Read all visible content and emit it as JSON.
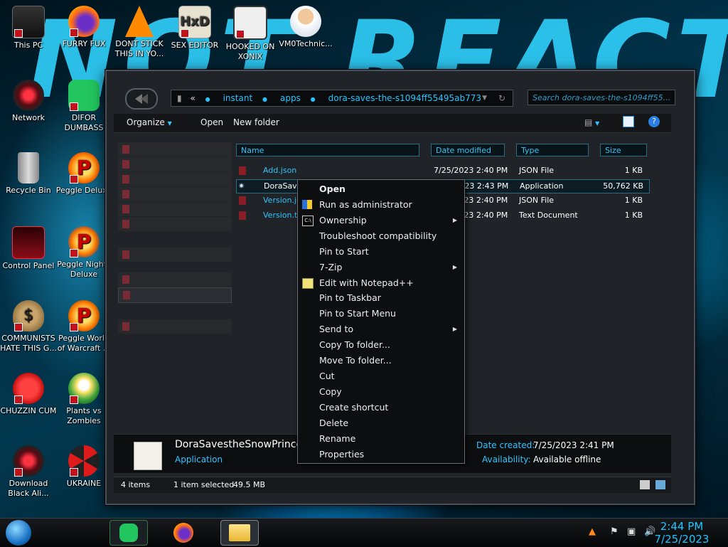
{
  "desktop": {
    "icons": [
      {
        "label": "This PC"
      },
      {
        "label": "FURRY FUX"
      },
      {
        "label": "DONT STICK THIS IN YO..."
      },
      {
        "label": "SEX EDITOR"
      },
      {
        "label": "HOOKED ON XONIX"
      },
      {
        "label": "VM0Technic..."
      },
      {
        "label": "Network"
      },
      {
        "label": "DIFOR DUMBASS"
      },
      {
        "label": "Recycle Bin"
      },
      {
        "label": "Peggle Deluxe"
      },
      {
        "label": "Control Panel"
      },
      {
        "label": "Peggle Nights Deluxe"
      },
      {
        "label": "COMMUNISTS HATE THIS G..."
      },
      {
        "label": "Peggle World of Warcraft ..."
      },
      {
        "label": "CHUZZIN CUM"
      },
      {
        "label": "Plants vs Zombies"
      },
      {
        "label": "Download Black Ali..."
      },
      {
        "label": "UKRAINE"
      }
    ]
  },
  "explorer": {
    "breadcrumb": [
      "instant",
      "apps",
      "dora-saves-the-s1094ff55495ab773"
    ],
    "breadcrumb_prefix": "«",
    "search_placeholder": "Search dora-saves-the-s1094ff55...",
    "toolbar": {
      "organize": "Organize",
      "open": "Open",
      "new_folder": "New folder"
    },
    "columns": {
      "name": "Name",
      "date": "Date modified",
      "type": "Type",
      "size": "Size"
    },
    "files": [
      {
        "name": "Add.json",
        "date": "7/25/2023 2:40 PM",
        "type": "JSON File",
        "size": "1 KB"
      },
      {
        "name": "DoraSaves",
        "date": "7/25/2023 2:43 PM",
        "type": "Application",
        "size": "50,762 KB"
      },
      {
        "name": "Version.json",
        "date": "7/25/2023 2:40 PM",
        "type": "JSON File",
        "size": "1 KB"
      },
      {
        "name": "Version.txt",
        "date": "7/25/2023 2:40 PM",
        "type": "Text Document",
        "size": "1 KB"
      }
    ],
    "details": {
      "filename": "DoraSavestheSnowPrinces",
      "filetype": "Application",
      "created_label": "Date created:",
      "created_value": "7/25/2023 2:41 PM",
      "avail_label": "Availability:",
      "avail_value": "Available offline"
    },
    "status": {
      "items": "4 items",
      "selected": "1 item selected",
      "size": "49.5 MB"
    }
  },
  "context_menu": [
    {
      "label": "Open",
      "bold": true
    },
    {
      "label": "Run as administrator",
      "icon": "shield-icon"
    },
    {
      "label": "Ownership",
      "icon": "cmd-icon",
      "submenu": true
    },
    {
      "label": "Troubleshoot compatibility"
    },
    {
      "label": "Pin to Start"
    },
    {
      "label": "7-Zip",
      "submenu": true
    },
    {
      "label": "Edit with Notepad++",
      "icon": "notepad-icon"
    },
    {
      "label": "Pin to Taskbar"
    },
    {
      "label": "Pin to Start Menu"
    },
    {
      "label": "Send to",
      "submenu": true
    },
    {
      "label": "Copy To folder..."
    },
    {
      "label": "Move To folder..."
    },
    {
      "label": "Cut"
    },
    {
      "label": "Copy"
    },
    {
      "label": "Create shortcut"
    },
    {
      "label": "Delete"
    },
    {
      "label": "Rename"
    },
    {
      "label": "Properties"
    }
  ],
  "taskbar": {
    "time": "2:44 PM",
    "date": "7/25/2023"
  },
  "colors": {
    "accent": "#22c5ff",
    "window_bg": "#0b0c0d",
    "menu_bg": "#0d0e0f"
  }
}
